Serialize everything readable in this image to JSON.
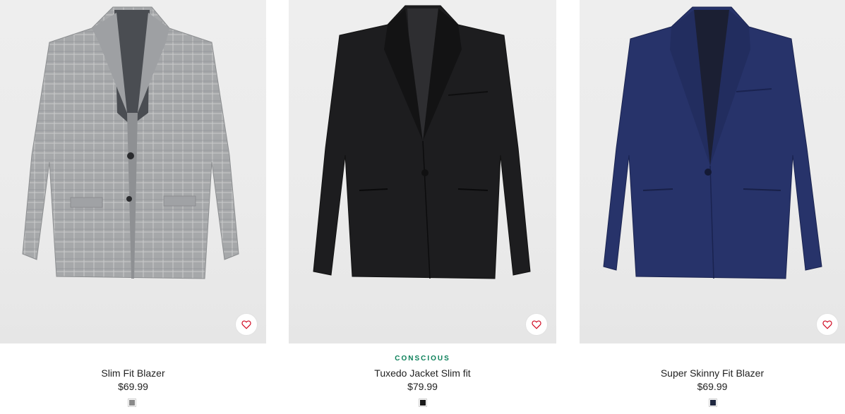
{
  "products": [
    {
      "name": "Slim Fit Blazer",
      "price": "$69.99",
      "badge": "",
      "swatch_color": "#8a8a8a",
      "jacket_color": "#a9abad",
      "image_icon": "gray-check-blazer"
    },
    {
      "name": "Tuxedo Jacket Slim fit",
      "price": "$79.99",
      "badge": "CONSCIOUS",
      "swatch_color": "#1a1a1a",
      "jacket_color": "#1c1c1e",
      "image_icon": "black-tuxedo-jacket"
    },
    {
      "name": "Super Skinny Fit Blazer",
      "price": "$69.99",
      "badge": "",
      "swatch_color": "#1f2740",
      "jacket_color": "#27336a",
      "image_icon": "navy-blazer"
    }
  ],
  "favorite_icon": "heart-icon",
  "badge_color": "#0a7f58"
}
